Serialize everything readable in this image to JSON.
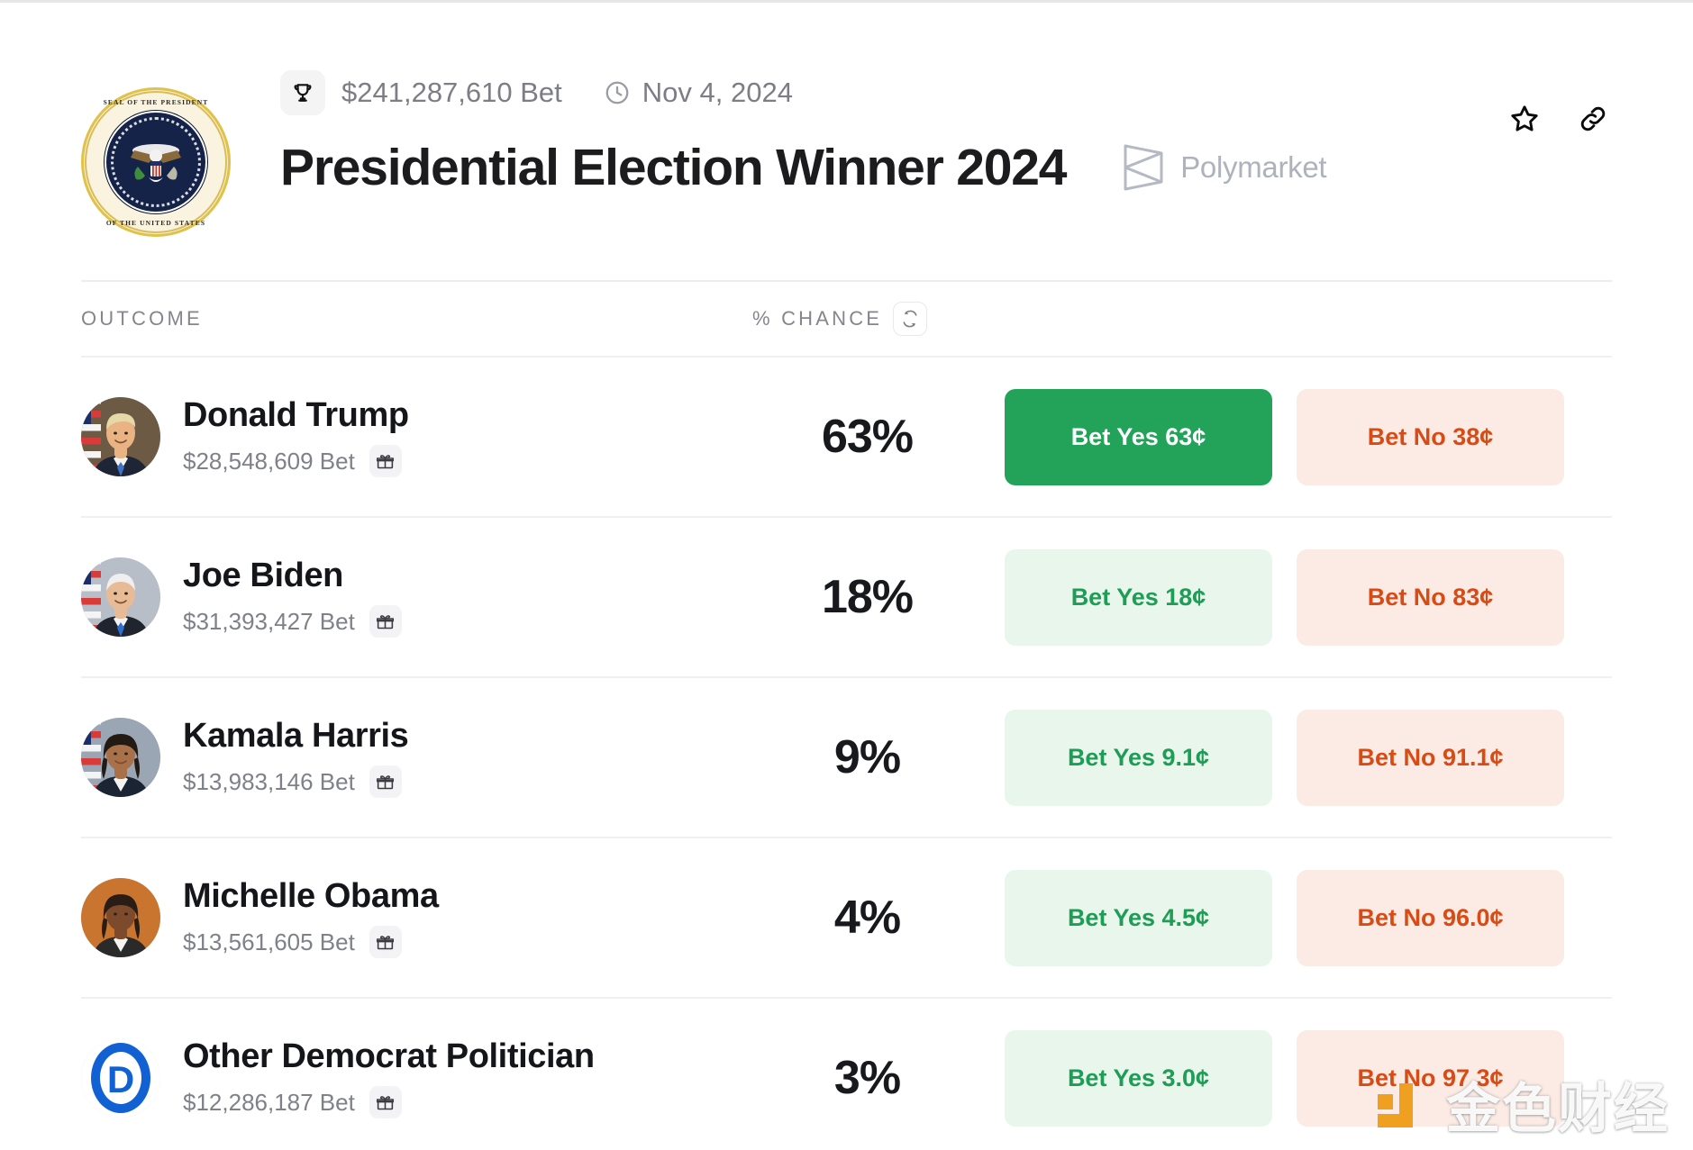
{
  "header": {
    "seal_alt": "presidential-seal",
    "seal_text_top": "SEAL OF THE PRESIDENT",
    "seal_text_bottom": "OF THE UNITED STATES",
    "volume_label": "$241,287,610 Bet",
    "date_label": "Nov 4, 2024",
    "title": "Presidential Election Winner 2024",
    "brand_name": "Polymarket",
    "trophy_icon": "trophy-icon",
    "clock_icon": "clock-icon",
    "star_icon": "star-icon",
    "link_icon": "link-icon"
  },
  "table": {
    "col_outcome": "OUTCOME",
    "col_chance": "% CHANCE",
    "refresh_icon": "refresh-icon",
    "gift_icon": "gift-icon",
    "rows": [
      {
        "name": "Donald Trump",
        "bet": "$28,548,609 Bet",
        "chance": "63%",
        "yes_label": "Bet Yes 63¢",
        "no_label": "Bet No 38¢",
        "yes_style": "solid",
        "avatar": "donald-trump"
      },
      {
        "name": "Joe Biden",
        "bet": "$31,393,427 Bet",
        "chance": "18%",
        "yes_label": "Bet Yes 18¢",
        "no_label": "Bet No 83¢",
        "yes_style": "soft",
        "avatar": "joe-biden"
      },
      {
        "name": "Kamala Harris",
        "bet": "$13,983,146 Bet",
        "chance": "9%",
        "yes_label": "Bet Yes 9.1¢",
        "no_label": "Bet No 91.1¢",
        "yes_style": "soft",
        "avatar": "kamala-harris"
      },
      {
        "name": "Michelle Obama",
        "bet": "$13,561,605 Bet",
        "chance": "4%",
        "yes_label": "Bet Yes 4.5¢",
        "no_label": "Bet No 96.0¢",
        "yes_style": "soft",
        "avatar": "michelle-obama"
      },
      {
        "name": "Other Democrat Politician",
        "bet": "$12,286,187 Bet",
        "chance": "3%",
        "yes_label": "Bet Yes 3.0¢",
        "no_label": "Bet No 97.3¢",
        "yes_style": "soft",
        "avatar": "democratic-party-logo"
      }
    ]
  },
  "watermark": {
    "text": "金色财经",
    "logo_color": "#f0a020"
  },
  "colors": {
    "yes_solid_bg": "#23a35a",
    "yes_soft_bg": "#e8f6ec",
    "yes_soft_text": "#1d9d55",
    "no_soft_bg": "#fcebe5",
    "no_soft_text": "#d94b14",
    "title": "#1c1c1e",
    "muted": "#7d7d85"
  }
}
